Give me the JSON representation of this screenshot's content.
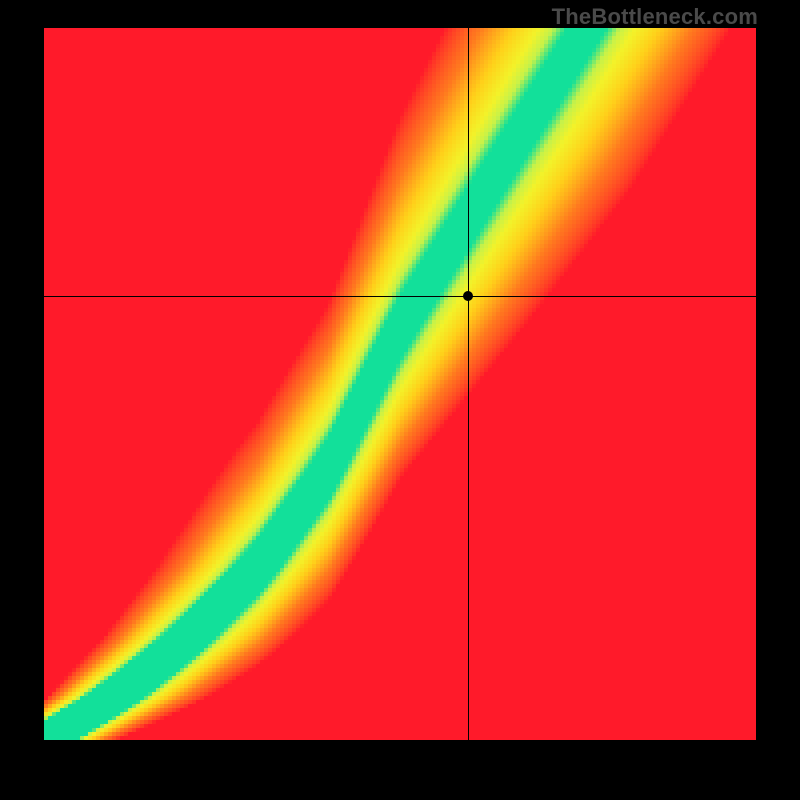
{
  "watermark": "TheBottleneck.com",
  "chart_data": {
    "type": "heatmap",
    "title": "",
    "xlabel": "",
    "ylabel": "",
    "xlim": [
      0,
      1
    ],
    "ylim": [
      0,
      1
    ],
    "grid": false,
    "legend": false,
    "crosshair": {
      "x": 0.595,
      "y": 0.623
    },
    "marker": {
      "x": 0.595,
      "y": 0.623
    },
    "ridge": {
      "description": "Green optimal-balance ridge through the heatmap, from bottom-left to top-right with an S-curve.",
      "points": [
        {
          "x": 0.0,
          "y": 0.0
        },
        {
          "x": 0.1,
          "y": 0.06
        },
        {
          "x": 0.2,
          "y": 0.14
        },
        {
          "x": 0.3,
          "y": 0.24
        },
        {
          "x": 0.4,
          "y": 0.38
        },
        {
          "x": 0.45,
          "y": 0.48
        },
        {
          "x": 0.5,
          "y": 0.58
        },
        {
          "x": 0.55,
          "y": 0.66
        },
        {
          "x": 0.6,
          "y": 0.74
        },
        {
          "x": 0.65,
          "y": 0.82
        },
        {
          "x": 0.7,
          "y": 0.9
        },
        {
          "x": 0.75,
          "y": 0.98
        }
      ],
      "half_width_start": 0.012,
      "half_width_end": 0.1
    },
    "color_stops": [
      {
        "t": 0.0,
        "color": "#ff1a2a"
      },
      {
        "t": 0.45,
        "color": "#ff7a1f"
      },
      {
        "t": 0.7,
        "color": "#ffd11a"
      },
      {
        "t": 0.85,
        "color": "#f3f32a"
      },
      {
        "t": 0.93,
        "color": "#c6f24a"
      },
      {
        "t": 1.0,
        "color": "#12e09a"
      }
    ],
    "resolution": 178
  }
}
